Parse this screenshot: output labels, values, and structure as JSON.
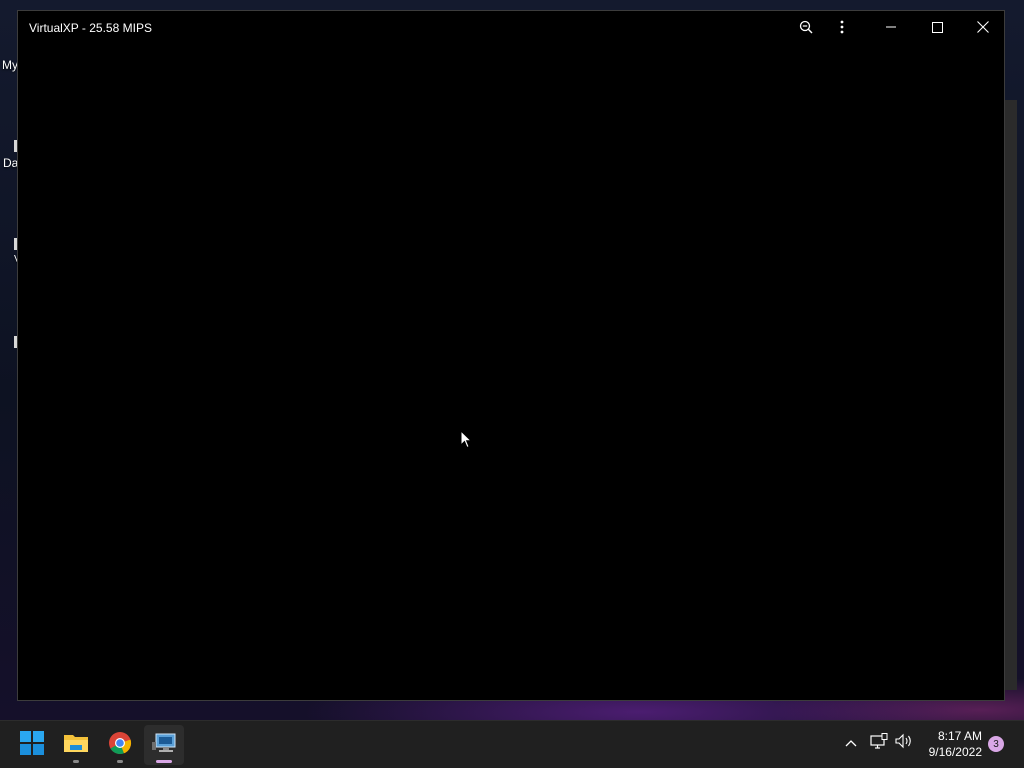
{
  "window": {
    "title": "VirtualXP - 25.58 MIPS",
    "buttons": {
      "zoom": "zoom-out-icon",
      "more": "more-vertical-icon",
      "minimize": "minimize-icon",
      "maximize": "maximize-icon",
      "close": "close-icon"
    }
  },
  "desktop": {
    "icons": [
      {
        "label": "My"
      },
      {
        "label": "Da"
      },
      {
        "label": "V"
      }
    ]
  },
  "taskbar": {
    "apps": [
      {
        "name": "Start",
        "icon": "windows-logo-icon"
      },
      {
        "name": "File Explorer",
        "icon": "folder-icon"
      },
      {
        "name": "Google Chrome",
        "icon": "chrome-icon"
      },
      {
        "name": "VirtualXP",
        "icon": "virtual-pc-icon"
      }
    ],
    "tray": {
      "chevron": "chevron-up-icon",
      "network": "network-icon",
      "volume": "speaker-icon"
    },
    "clock": {
      "time": "8:17 AM",
      "date": "9/16/2022"
    },
    "notifications": "3"
  },
  "colors": {
    "accent": "#d9a7e6",
    "taskbar": "#202020",
    "window_bg": "#000000"
  }
}
